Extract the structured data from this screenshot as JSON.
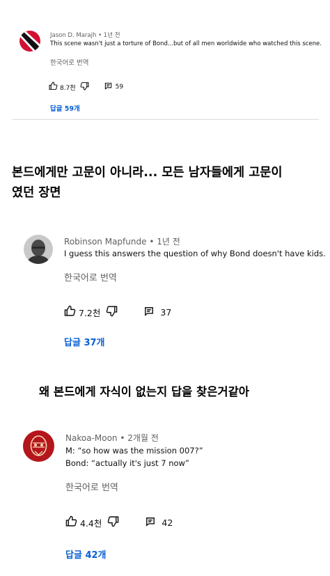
{
  "comments": [
    {
      "author": "Jason D. Marajh",
      "time": "• 1년 전",
      "text": [
        "This scene wasn't just a torture of Bond...but of all men worldwide who watched this scene."
      ],
      "translate": "한국어로 번역",
      "likes": "8.7천",
      "replies_count": "59",
      "reply_link": "답글 59개",
      "avatar_icon": "trinidad-flag-avatar"
    },
    {
      "author": "Robinson Mapfunde",
      "time": "• 1년 전",
      "text": [
        "I guess this answers the question of why Bond doesn't have kids."
      ],
      "translate": "한국어로 번역",
      "likes": "7.2천",
      "replies_count": "37",
      "reply_link": "답글 37개",
      "avatar_icon": "portrait-photo-avatar"
    },
    {
      "author": "Nakoa-Moon",
      "time": "• 2개월 전",
      "text": [
        "M: “so how was the mission 007?”",
        "Bond: “actually it's just 7 now”"
      ],
      "translate": "한국어로 번역",
      "likes": "4.4천",
      "replies_count": "42",
      "reply_link": "답글 42개",
      "avatar_icon": "red-mask-avatar"
    }
  ],
  "captions": [
    [
      "본드에게만 고문이 아니라... 모든 남자들에게 고문이",
      "였던 장면"
    ],
    [
      "왜 본드에게 자식이 없는지 답을 찾은거같아"
    ]
  ],
  "colors": {
    "link": "#065fd4",
    "meta": "#606060",
    "text": "#0f0f0f"
  }
}
